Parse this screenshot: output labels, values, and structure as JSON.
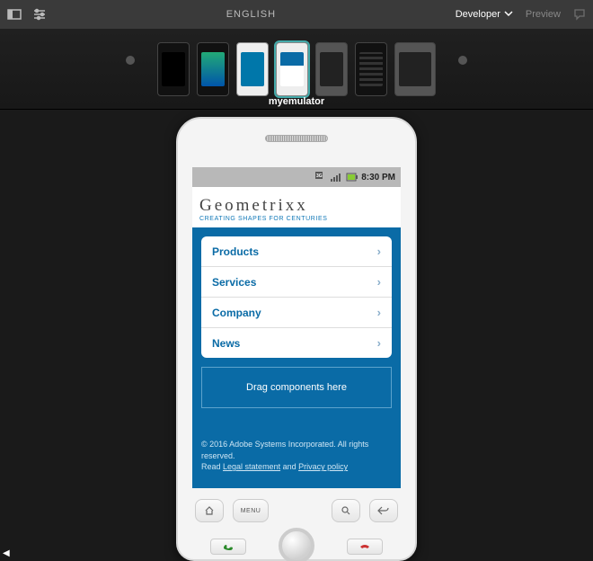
{
  "topbar": {
    "language": "ENGLISH",
    "mode": "Developer",
    "preview": "Preview"
  },
  "carousel": {
    "selected_label": "myemulator"
  },
  "phone": {
    "status": {
      "time": "8:30 PM"
    },
    "brand": {
      "name": "Geometrixx",
      "tagline": "CREATING SHAPES FOR CENTURIES"
    },
    "menu": [
      "Products",
      "Services",
      "Company",
      "News"
    ],
    "dropzone": "Drag components here",
    "footer": {
      "copyright": "© 2016 Adobe Systems Incorporated. All rights reserved.",
      "read": "Read ",
      "legal": "Legal statement",
      "and": " and ",
      "privacy": "Privacy policy"
    },
    "hw": {
      "menu": "MENU"
    }
  },
  "scroll_hint": "◀"
}
